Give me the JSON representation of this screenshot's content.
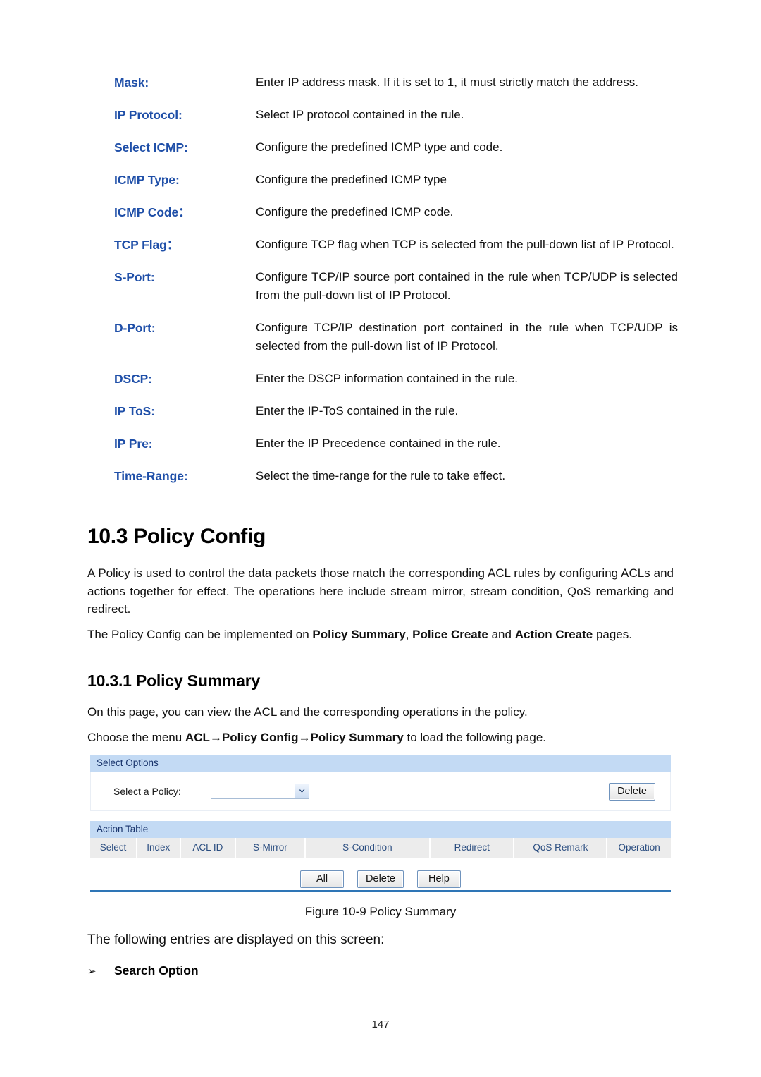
{
  "definitions": [
    {
      "term": "Mask:",
      "desc": "Enter IP address mask. If it is set to 1, it must strictly match the address."
    },
    {
      "term": "IP Protocol:",
      "desc": "Select IP protocol contained in the rule."
    },
    {
      "term": "Select ICMP:",
      "desc": "Configure the predefined ICMP type and code."
    },
    {
      "term": "ICMP Type:",
      "desc": "Configure the predefined ICMP type"
    },
    {
      "term": "ICMP Code：",
      "desc": "Configure the predefined ICMP code."
    },
    {
      "term": "TCP Flag：",
      "desc": "Configure TCP flag when TCP is selected from the pull-down list of IP Protocol."
    },
    {
      "term": "S-Port:",
      "desc": "Configure TCP/IP source port contained in the rule when TCP/UDP is selected from the pull-down list of IP Protocol."
    },
    {
      "term": "D-Port:",
      "desc": "Configure TCP/IP destination port contained in the rule when TCP/UDP is selected from the pull-down list of IP Protocol."
    },
    {
      "term": "DSCP:",
      "desc": "Enter the DSCP information contained in the rule."
    },
    {
      "term": "IP ToS:",
      "desc": "Enter the IP-ToS contained in the rule."
    },
    {
      "term": "IP Pre:",
      "desc": "Enter the IP Precedence contained in the rule."
    },
    {
      "term": "Time-Range:",
      "desc": "Select the time-range for the rule to take effect."
    }
  ],
  "section": {
    "heading": "10.3 Policy Config",
    "intro": "A Policy is used to control the data packets those match the corresponding ACL rules by configuring ACLs and actions together for effect. The operations here include stream mirror, stream condition, QoS remarking and redirect.",
    "pages_prefix": "The Policy Config can be implemented on ",
    "pages_bold1": "Policy Summary",
    "pages_sep1": ", ",
    "pages_bold2": "Police Create",
    "pages_sep2": " and ",
    "pages_bold3": "Action Create",
    "pages_suffix": " pages."
  },
  "subsection": {
    "heading": "10.3.1  Policy Summary",
    "onthis": "On this page, you can view the ACL and the corresponding operations in the policy.",
    "choose_prefix": "Choose the menu ",
    "choose_bold": "ACL→Policy Config→Policy Summary",
    "choose_suffix": " to load the following page."
  },
  "figure": {
    "caption": "Figure 10-9 Policy Summary",
    "select_options": {
      "panel_title": "Select Options",
      "policy_label": "Select a Policy:",
      "policy_value": "",
      "dropdown_arrow": "chevron-down-icon",
      "delete_label": "Delete"
    },
    "action_table": {
      "panel_title": "Action Table",
      "columns": [
        "Select",
        "Index",
        "ACL ID",
        "S-Mirror",
        "S-Condition",
        "Redirect",
        "QoS Remark",
        "Operation"
      ],
      "rows": []
    },
    "buttons": [
      "All",
      "Delete",
      "Help"
    ]
  },
  "footer_text": {
    "following": "The following entries are displayed on this screen:",
    "bullet_glyph": "➢",
    "bullet_label": "Search Option"
  },
  "page_number": "147",
  "colors": {
    "label_blue": "#1F4FA8",
    "panel_header_blue": "#C3DAF4",
    "panel_header_text": "#18336B",
    "rule_blue": "#2E75B6",
    "table_header_bg": "#ECECEC",
    "table_header_text": "#2A4D80"
  }
}
